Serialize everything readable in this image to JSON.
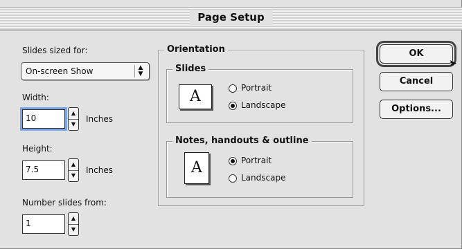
{
  "window": {
    "title": "Page Setup"
  },
  "slides_sized": {
    "label": "Slides sized for:",
    "value": "On-screen Show"
  },
  "width": {
    "label": "Width:",
    "value": "10",
    "unit": "Inches"
  },
  "height": {
    "label": "Height:",
    "value": "7.5",
    "unit": "Inches"
  },
  "number_from": {
    "label": "Number slides from:",
    "value": "1"
  },
  "orientation": {
    "label": "Orientation",
    "slides": {
      "label": "Slides",
      "portrait": "Portrait",
      "landscape": "Landscape",
      "selected": "Landscape"
    },
    "notes": {
      "label": "Notes, handouts & outline",
      "portrait": "Portrait",
      "landscape": "Landscape",
      "selected": "Portrait"
    },
    "icon_letter": "A"
  },
  "buttons": {
    "ok": "OK",
    "cancel": "Cancel",
    "options": "Options..."
  }
}
